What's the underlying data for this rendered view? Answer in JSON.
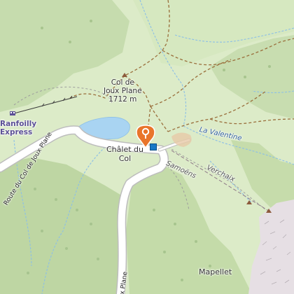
{
  "map": {
    "labels": {
      "col_name_line1": "Col de",
      "col_name_line2": "Joux Plane",
      "col_elevation": "1712 m",
      "chalet_line1": "Châlet du",
      "chalet_line2": "Col",
      "ranfoilly_line1": "Ranfoilly",
      "ranfoilly_line2": "Express",
      "la_valentine": "La Valentine",
      "samoens": "Samoëns",
      "verchaix": "Verchaix",
      "mapellet": "Mapellet",
      "road_col": "Route du Col de Joux Plane",
      "road_bottom": "x Plane"
    },
    "colors": {
      "grass": "#dcebc8",
      "forest": "#c2d9a8",
      "water": "#a9d4f2",
      "road": "#ffffff",
      "path": "#9a6f3c",
      "rock": "#e8e1e6",
      "marker": "#e9752b"
    },
    "icons": [
      "map-pin-icon",
      "parking-icon",
      "cable-car-icon",
      "peak-icon",
      "viewpoint-icon"
    ]
  }
}
